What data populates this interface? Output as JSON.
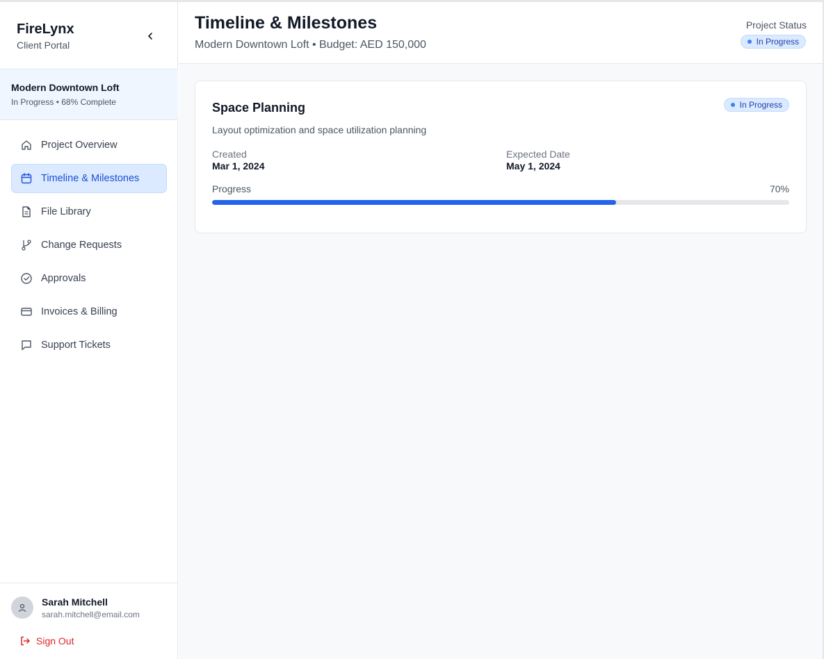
{
  "brand": {
    "name": "FireLynx",
    "subtitle": "Client Portal"
  },
  "project": {
    "name": "Modern Downtown Loft",
    "meta": "In Progress • 68% Complete"
  },
  "nav": {
    "items": [
      {
        "label": "Project Overview",
        "icon": "home-icon",
        "active": false
      },
      {
        "label": "Timeline & Milestones",
        "icon": "calendar-icon",
        "active": true
      },
      {
        "label": "File Library",
        "icon": "file-icon",
        "active": false
      },
      {
        "label": "Change Requests",
        "icon": "git-branch-icon",
        "active": false
      },
      {
        "label": "Approvals",
        "icon": "check-circle-icon",
        "active": false
      },
      {
        "label": "Invoices & Billing",
        "icon": "credit-card-icon",
        "active": false
      },
      {
        "label": "Support Tickets",
        "icon": "message-icon",
        "active": false
      }
    ]
  },
  "user": {
    "name": "Sarah Mitchell",
    "email": "sarah.mitchell@email.com",
    "signout_label": "Sign Out"
  },
  "header": {
    "title": "Timeline & Milestones",
    "subtitle": "Modern Downtown Loft • Budget: AED 150,000",
    "status_label": "Project Status",
    "status_value": "In Progress"
  },
  "milestone": {
    "title": "Space Planning",
    "status": "In Progress",
    "description": "Layout optimization and space utilization planning",
    "created_label": "Created",
    "created_value": "Mar 1, 2024",
    "expected_label": "Expected Date",
    "expected_value": "May 1, 2024",
    "progress_label": "Progress",
    "progress_text": "70%",
    "progress_fraction": 0.7
  },
  "colors": {
    "accent": "#2563eb",
    "active_nav_bg": "#dbeafe",
    "danger": "#dc2626",
    "badge_bg": "#dbeafe"
  }
}
